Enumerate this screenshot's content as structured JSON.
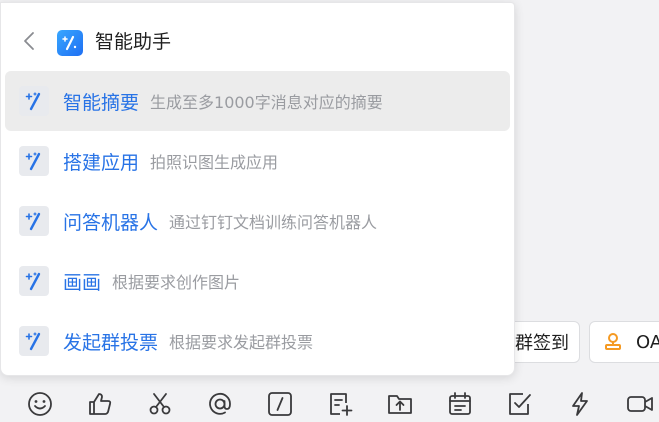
{
  "header": {
    "title": "智能助手"
  },
  "menu": {
    "items": [
      {
        "name": "智能摘要",
        "desc": "生成至多1000字消息对应的摘要",
        "active": true
      },
      {
        "name": "搭建应用",
        "desc": "拍照识图生成应用",
        "active": false
      },
      {
        "name": "问答机器人",
        "desc": "通过钉钉文档训练问答机器人",
        "active": false
      },
      {
        "name": "画画",
        "desc": "根据要求创作图片",
        "active": false
      },
      {
        "name": "发起群投票",
        "desc": "根据要求发起群投票",
        "active": false
      }
    ]
  },
  "chips": {
    "sign_in_label": "群签到",
    "oa_label": "OA"
  },
  "toolbar": {
    "icons": [
      "emoji-icon",
      "thumbs-up-icon",
      "scissors-icon",
      "mention-icon",
      "slash-command-icon",
      "add-doc-icon",
      "upload-folder-icon",
      "calendar-icon",
      "task-check-icon",
      "lightning-icon",
      "video-call-icon"
    ]
  },
  "colors": {
    "accent": "#2873e6",
    "desc_text": "#9a9ca1",
    "active_row": "#ececec"
  }
}
